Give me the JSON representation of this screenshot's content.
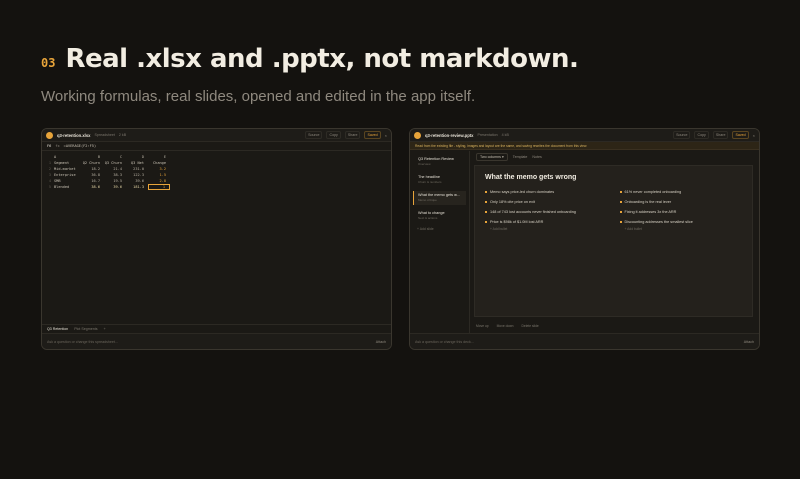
{
  "hero": {
    "number": "03",
    "headline": "Real .xlsx and .pptx, not markdown.",
    "subtitle": "Working formulas, real slides, opened and edited in the app itself."
  },
  "sheet_window": {
    "filename": "q3-retention.xlsx",
    "tag": "Spreadsheet",
    "size": "2 kB",
    "buttons": [
      "Source",
      "Copy",
      "Share",
      "Saved"
    ],
    "formula": {
      "ref": "F6",
      "fx": "fx",
      "text": "=AVERAGE(F2:F5)"
    },
    "col_letters": [
      "",
      "A",
      "B",
      "C",
      "D",
      "E"
    ],
    "headers": [
      "Segment",
      "Q2 Churn",
      "Q3 Churn",
      "Q3 Net",
      "Change"
    ],
    "rows": [
      [
        "Mid-market",
        "18.2",
        "21.4",
        "231.0",
        "3.2"
      ],
      [
        "Enterprise",
        "36.8",
        "38.3",
        "122.3",
        "1.5"
      ],
      [
        "SMB",
        "16.7",
        "19.5",
        "39.6",
        "2.8"
      ],
      [
        "Blended",
        "38.6",
        "39.6",
        "181.3",
        "1"
      ]
    ],
    "row_numbers": [
      "1",
      "2",
      "3",
      "4",
      "5"
    ],
    "sheets": [
      "Q3 Retention",
      "Plot Segments",
      "+"
    ],
    "command_placeholder": "Ask a question or change this spreadsheet...",
    "command_button": "Attach"
  },
  "deck_window": {
    "filename": "q3-retention-review.pptx",
    "tag": "Presentation",
    "size": "4 kB",
    "buttons": [
      "Source",
      "Copy",
      "Share",
      "Saved"
    ],
    "banner": "Read from the existing file - styling, images and layout are the same, and saving rewrites the document from this view.",
    "slides": [
      {
        "title": "Q3 Retention Review",
        "sub": "Overview"
      },
      {
        "title": "The headline",
        "sub": "Churn & numbers"
      },
      {
        "title": "What the memo gets w...",
        "sub": "Memo critique"
      },
      {
        "title": "What to change",
        "sub": "Next & actions"
      }
    ],
    "add_slide": "+ Add slide",
    "toolbar": {
      "layout": "Two columns",
      "b1": "Template",
      "b2": "Notes"
    },
    "slide_title": "What the memo gets wrong",
    "left_bullets": [
      "Memo says price-led churn dominates",
      "Only 18% cite price on exit",
      "148 of 743 lost accounts never finished onboarding",
      "Price is $98k of $1.0M lost ARR"
    ],
    "right_bullets": [
      "61% never completed onboarding",
      "Onboarding is the real lever",
      "Fixing it addresses 3x the ARR",
      "Discounting addresses the smallest slice"
    ],
    "add_bullet": "+ Add bullet",
    "bottom_bar": [
      "Move up",
      "Move down",
      "Delete slide"
    ],
    "command_placeholder": "Ask a question or change this deck...",
    "command_button": "Attach"
  }
}
